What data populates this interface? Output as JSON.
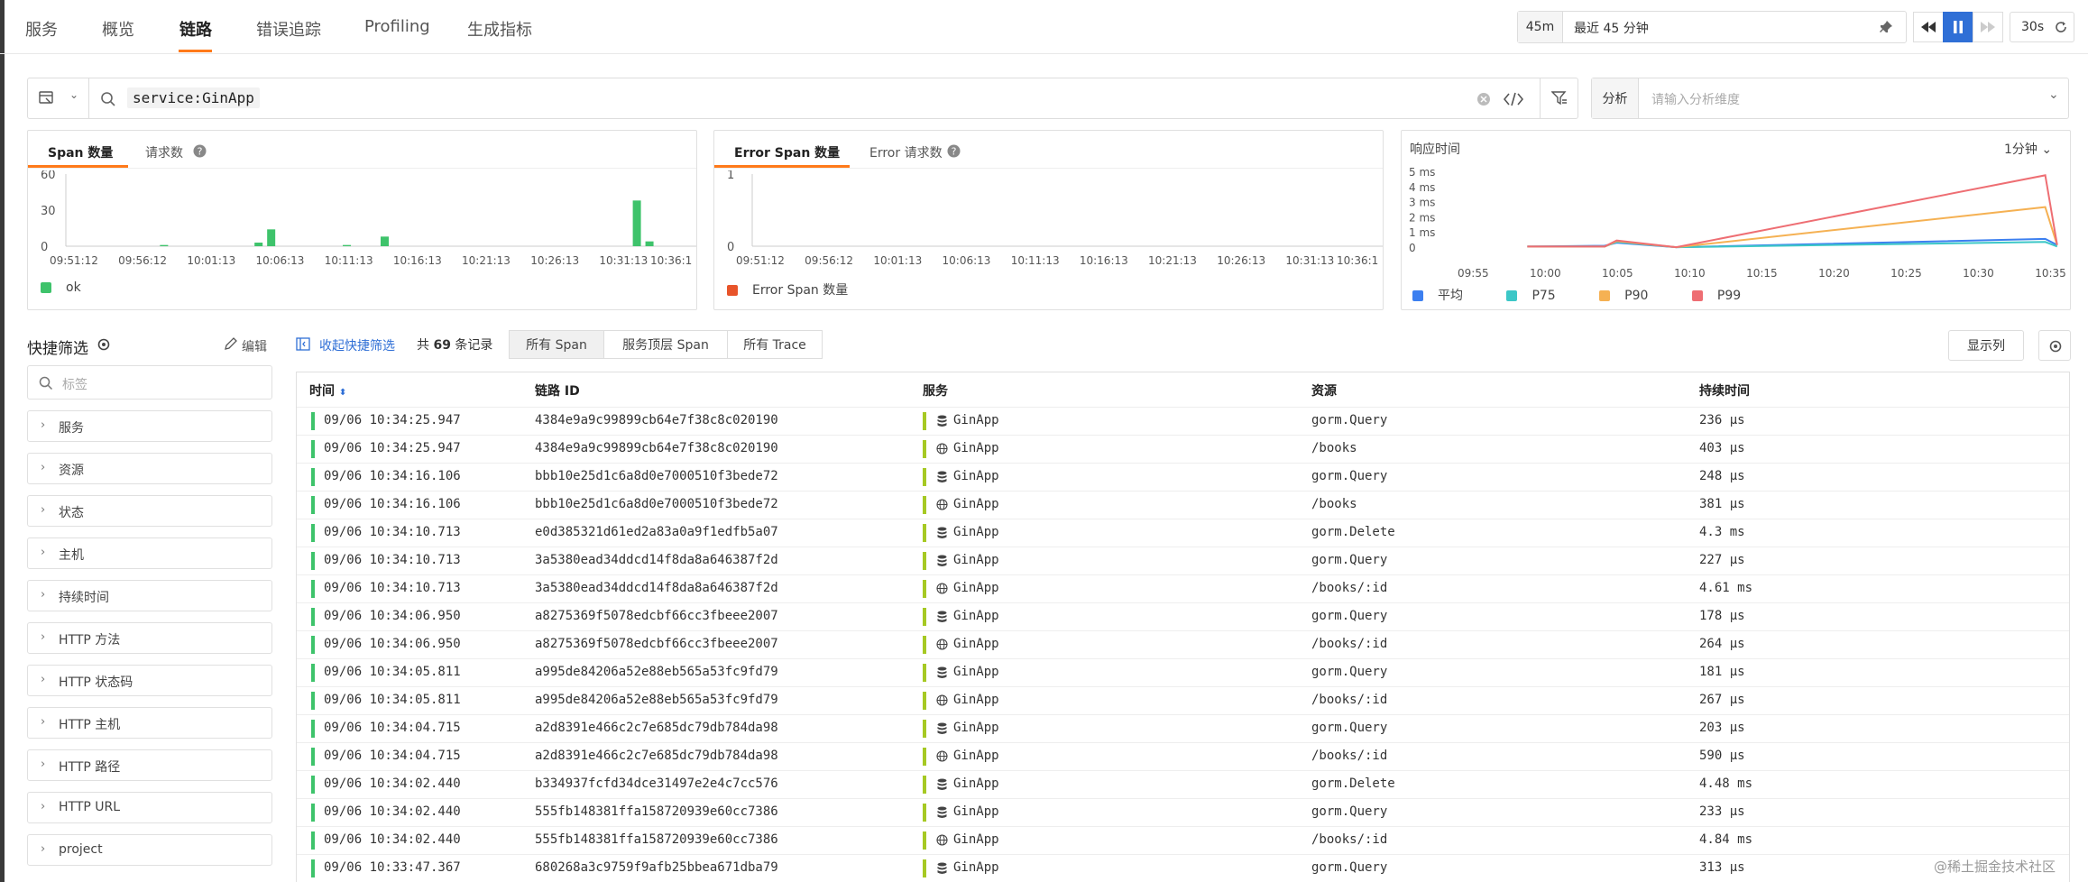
{
  "nav": {
    "tabs": [
      "服务",
      "概览",
      "链路",
      "错误追踪",
      "Profiling",
      "生成指标"
    ],
    "active": 2
  },
  "time": {
    "short": "45m",
    "range": "最近 45 分钟",
    "refresh": "30s"
  },
  "query": {
    "text": "service:GinApp",
    "analyze_label": "分析",
    "analyze_placeholder": "请输入分析维度"
  },
  "panel1": {
    "tab1": "Span 数量",
    "tab2": "请求数",
    "legend": "ok",
    "color": "#3ec36b"
  },
  "panel2": {
    "tab1": "Error Span 数量",
    "tab2": "Error 请求数",
    "legend": "Error Span 数量",
    "color": "#e8542a"
  },
  "panel3": {
    "title": "响应时间",
    "interval": "1分钟",
    "legend": [
      "平均",
      "P75",
      "P90",
      "P99"
    ],
    "colors": [
      "#3c7ff0",
      "#3cc7c7",
      "#f5b153",
      "#ee6e73"
    ]
  },
  "chart_data": [
    {
      "type": "bar",
      "title": "Span 数量",
      "yticks": [
        "60",
        "30",
        "0"
      ],
      "ylim": [
        0,
        60
      ],
      "x": [
        "09:51:12",
        "09:56:12",
        "10:01:13",
        "10:06:13",
        "10:11:13",
        "10:16:13",
        "10:21:13",
        "10:26:13",
        "10:31:13",
        "10:36:1"
      ],
      "series": [
        {
          "name": "ok",
          "points": [
            [
              0.155,
              1
            ],
            [
              0.305,
              3
            ],
            [
              0.325,
              14
            ],
            [
              0.445,
              1
            ],
            [
              0.505,
              8
            ],
            [
              0.905,
              38
            ],
            [
              0.925,
              4
            ]
          ]
        }
      ]
    },
    {
      "type": "bar",
      "title": "Error Span 数量",
      "yticks": [
        "1",
        "0"
      ],
      "ylim": [
        0,
        1
      ],
      "x": [
        "09:51:12",
        "09:56:12",
        "10:01:13",
        "10:06:13",
        "10:11:13",
        "10:16:13",
        "10:21:13",
        "10:26:13",
        "10:31:13",
        "10:36:1"
      ],
      "series": [
        {
          "name": "Error Span 数量",
          "points": []
        }
      ]
    },
    {
      "type": "line",
      "title": "响应时间",
      "yticks": [
        "5 ms",
        "4 ms",
        "3 ms",
        "2 ms",
        "1 ms",
        "0"
      ],
      "ylim": [
        0,
        5
      ],
      "x": [
        "09:55",
        "10:00",
        "10:05",
        "10:10",
        "10:15",
        "10:20",
        "10:25",
        "10:30",
        "10:35"
      ],
      "series": [
        {
          "name": "平均",
          "points": [
            [
              0.09,
              0.1
            ],
            [
              0.22,
              0.15
            ],
            [
              0.24,
              0.35
            ],
            [
              0.34,
              0.05
            ],
            [
              0.96,
              0.6
            ],
            [
              0.98,
              0.2
            ]
          ]
        },
        {
          "name": "P75",
          "points": [
            [
              0.09,
              0.1
            ],
            [
              0.22,
              0.1
            ],
            [
              0.24,
              0.4
            ],
            [
              0.34,
              0.05
            ],
            [
              0.96,
              0.4
            ],
            [
              0.98,
              0.1
            ]
          ]
        },
        {
          "name": "P90",
          "points": [
            [
              0.09,
              0.1
            ],
            [
              0.22,
              0.1
            ],
            [
              0.24,
              0.45
            ],
            [
              0.34,
              0.05
            ],
            [
              0.96,
              2.7
            ],
            [
              0.98,
              0.2
            ]
          ]
        },
        {
          "name": "P99",
          "points": [
            [
              0.09,
              0.1
            ],
            [
              0.22,
              0.1
            ],
            [
              0.24,
              0.5
            ],
            [
              0.34,
              0.05
            ],
            [
              0.96,
              4.8
            ],
            [
              0.98,
              0.2
            ]
          ]
        }
      ]
    }
  ],
  "filters": {
    "title": "快捷筛选",
    "edit": "编辑",
    "search_placeholder": "标签",
    "items": [
      "服务",
      "资源",
      "状态",
      "主机",
      "持续时间",
      "HTTP 方法",
      "HTTP 状态码",
      "HTTP 主机",
      "HTTP 路径",
      "HTTP URL",
      "project"
    ]
  },
  "list": {
    "collapse": "收起快捷筛选",
    "count_pre": "共",
    "count": "69",
    "count_post": "条记录",
    "seg": [
      "所有 Span",
      "服务顶层 Span",
      "所有 Trace"
    ],
    "columns_btn": "显示列"
  },
  "table": {
    "headers": [
      "时间",
      "链路 ID",
      "服务",
      "资源",
      "持续时间"
    ],
    "rows": [
      [
        "09/06 10:34:25.947",
        "4384e9a9c99899cb64e7f38c8c020190",
        "db",
        "GinApp",
        "gorm.Query",
        "236 μs"
      ],
      [
        "09/06 10:34:25.947",
        "4384e9a9c99899cb64e7f38c8c020190",
        "web",
        "GinApp",
        "/books",
        "403 μs"
      ],
      [
        "09/06 10:34:16.106",
        "bbb10e25d1c6a8d0e7000510f3bede72",
        "db",
        "GinApp",
        "gorm.Query",
        "248 μs"
      ],
      [
        "09/06 10:34:16.106",
        "bbb10e25d1c6a8d0e7000510f3bede72",
        "web",
        "GinApp",
        "/books",
        "381 μs"
      ],
      [
        "09/06 10:34:10.713",
        "e0d385321d61ed2a83a0a9f1edfb5a07",
        "db",
        "GinApp",
        "gorm.Delete",
        "4.3 ms"
      ],
      [
        "09/06 10:34:10.713",
        "3a5380ead34ddcd14f8da8a646387f2d",
        "db",
        "GinApp",
        "gorm.Query",
        "227 μs"
      ],
      [
        "09/06 10:34:10.713",
        "3a5380ead34ddcd14f8da8a646387f2d",
        "web",
        "GinApp",
        "/books/:id",
        "4.61 ms"
      ],
      [
        "09/06 10:34:06.950",
        "a8275369f5078edcbf66cc3fbeee2007",
        "db",
        "GinApp",
        "gorm.Query",
        "178 μs"
      ],
      [
        "09/06 10:34:06.950",
        "a8275369f5078edcbf66cc3fbeee2007",
        "web",
        "GinApp",
        "/books/:id",
        "264 μs"
      ],
      [
        "09/06 10:34:05.811",
        "a995de84206a52e88eb565a53fc9fd79",
        "db",
        "GinApp",
        "gorm.Query",
        "181 μs"
      ],
      [
        "09/06 10:34:05.811",
        "a995de84206a52e88eb565a53fc9fd79",
        "web",
        "GinApp",
        "/books/:id",
        "267 μs"
      ],
      [
        "09/06 10:34:04.715",
        "a2d8391e466c2c7e685dc79db784da98",
        "db",
        "GinApp",
        "gorm.Query",
        "203 μs"
      ],
      [
        "09/06 10:34:04.715",
        "a2d8391e466c2c7e685dc79db784da98",
        "web",
        "GinApp",
        "/books/:id",
        "590 μs"
      ],
      [
        "09/06 10:34:02.440",
        "b334937fcfd34dce31497e2e4c7cc576",
        "db",
        "GinApp",
        "gorm.Delete",
        "4.48 ms"
      ],
      [
        "09/06 10:34:02.440",
        "555fb148381ffa158720939e60cc7386",
        "db",
        "GinApp",
        "gorm.Query",
        "233 μs"
      ],
      [
        "09/06 10:34:02.440",
        "555fb148381ffa158720939e60cc7386",
        "web",
        "GinApp",
        "/books/:id",
        "4.84 ms"
      ],
      [
        "09/06 10:33:47.367",
        "680268a3c9759f9afb25bbea671dba79",
        "db",
        "GinApp",
        "gorm.Query",
        "313 μs"
      ]
    ]
  },
  "watermark": "@稀土掘金技术社区"
}
